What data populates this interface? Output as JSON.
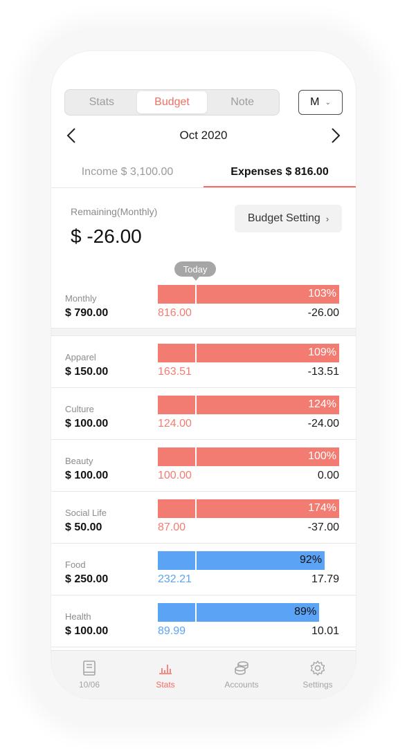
{
  "top": {
    "segments": [
      {
        "label": "Stats",
        "active": false
      },
      {
        "label": "Budget",
        "active": true
      },
      {
        "label": "Note",
        "active": false
      }
    ],
    "period": "M"
  },
  "month": {
    "label": "Oct 2020"
  },
  "tabs": {
    "income": "Income $ 3,100.00",
    "expenses": "Expenses $ 816.00"
  },
  "summary": {
    "remaining_label": "Remaining(Monthly)",
    "remaining_value": "$ -26.00",
    "budget_setting": "Budget Setting",
    "today": "Today"
  },
  "colors": {
    "over": "#f37c72",
    "under": "#5aa3f5",
    "accent": "#f26c62"
  },
  "rows": [
    {
      "name": "Monthly",
      "budget": "$ 790.00",
      "pct": "103%",
      "pct_value": 103,
      "spent": "816.00",
      "rest": "-26.00",
      "status": "over"
    },
    {
      "name": "Apparel",
      "budget": "$ 150.00",
      "pct": "109%",
      "pct_value": 109,
      "spent": "163.51",
      "rest": "-13.51",
      "status": "over"
    },
    {
      "name": "Culture",
      "budget": "$ 100.00",
      "pct": "124%",
      "pct_value": 124,
      "spent": "124.00",
      "rest": "-24.00",
      "status": "over"
    },
    {
      "name": "Beauty",
      "budget": "$ 100.00",
      "pct": "100%",
      "pct_value": 100,
      "spent": "100.00",
      "rest": "0.00",
      "status": "over"
    },
    {
      "name": "Social Life",
      "budget": "$ 50.00",
      "pct": "174%",
      "pct_value": 174,
      "spent": "87.00",
      "rest": "-37.00",
      "status": "over"
    },
    {
      "name": "Food",
      "budget": "$ 250.00",
      "pct": "92%",
      "pct_value": 92,
      "spent": "232.21",
      "rest": "17.79",
      "status": "under"
    },
    {
      "name": "Health",
      "budget": "$ 100.00",
      "pct": "89%",
      "pct_value": 89,
      "spent": "89.99",
      "rest": "10.01",
      "status": "under"
    }
  ],
  "bottom_nav": [
    {
      "label": "10/06",
      "icon": "book-icon",
      "active": false
    },
    {
      "label": "Stats",
      "icon": "bar-chart-icon",
      "active": true
    },
    {
      "label": "Accounts",
      "icon": "coins-icon",
      "active": false
    },
    {
      "label": "Settings",
      "icon": "gear-icon",
      "active": false
    }
  ]
}
